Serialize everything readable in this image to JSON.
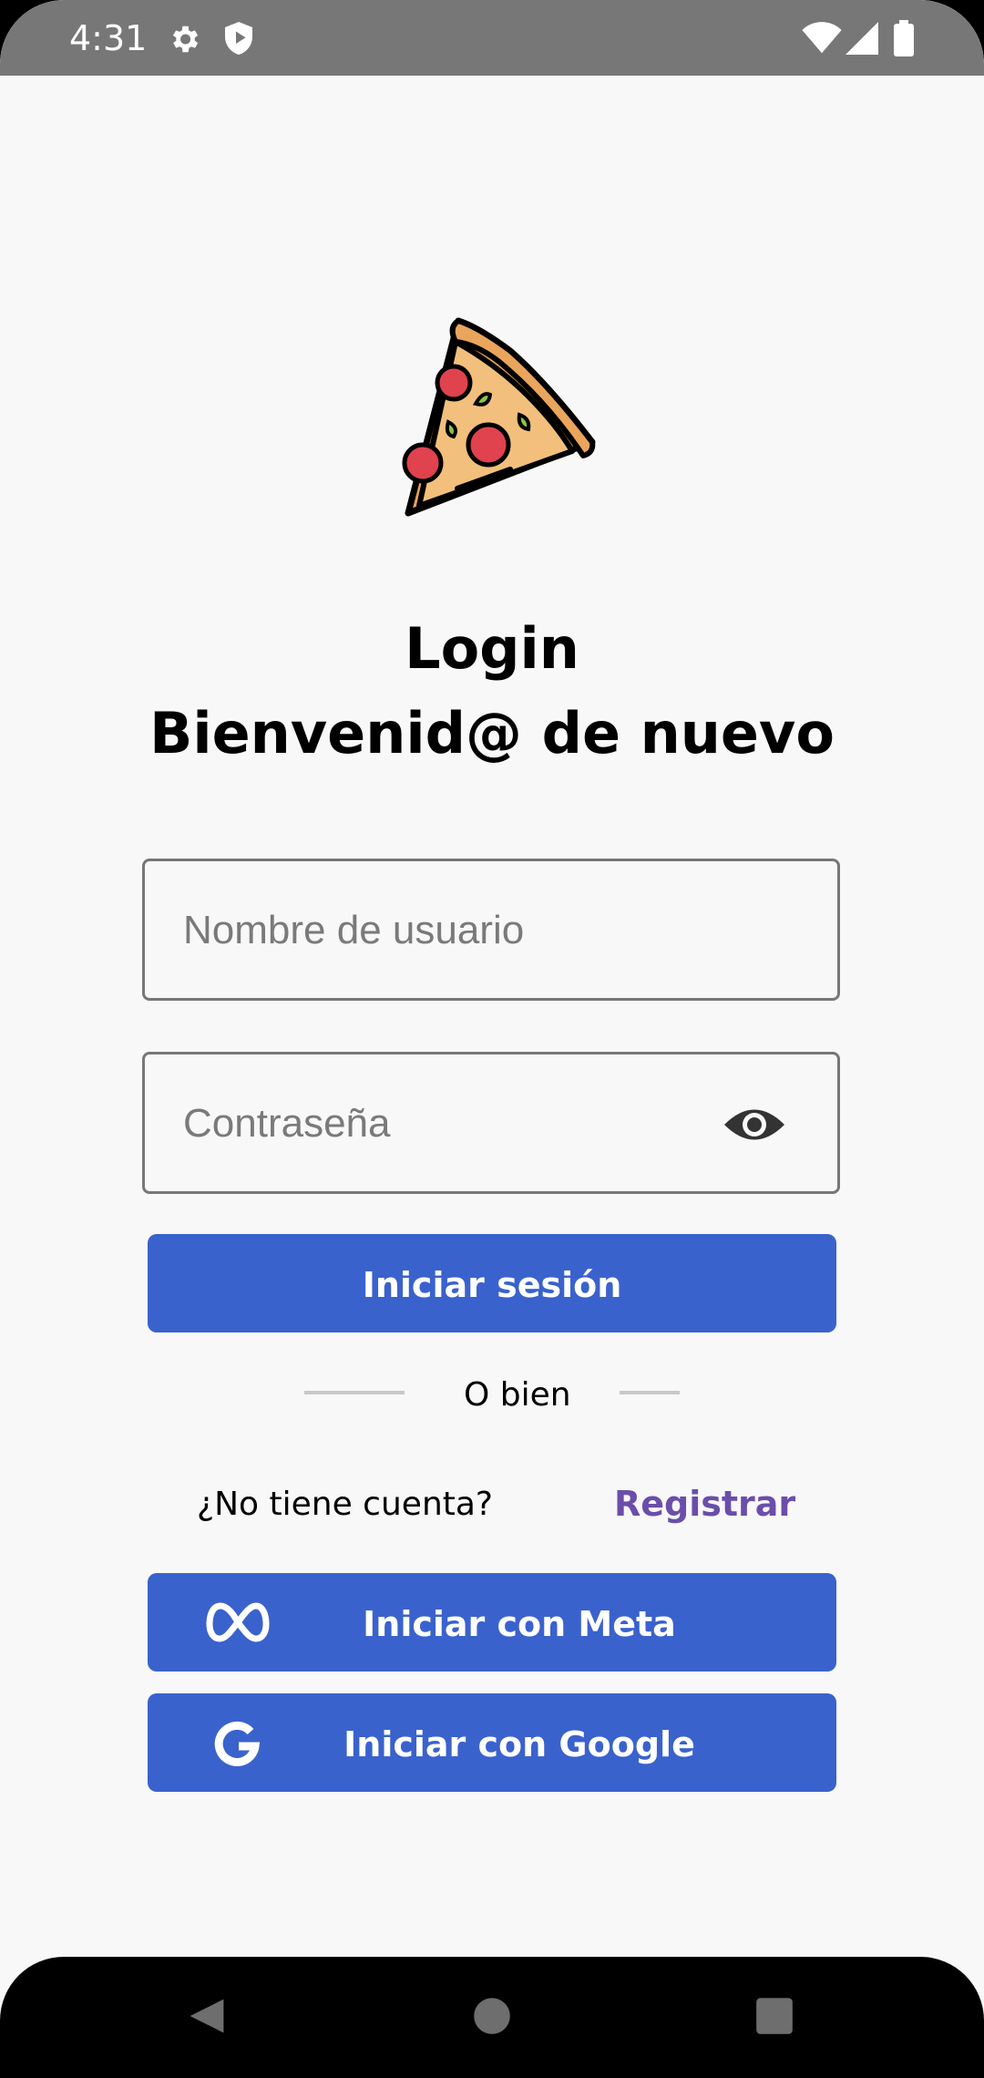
{
  "status_bar": {
    "time": "4:31",
    "icons": [
      "gear-icon",
      "shield-icon",
      "wifi-icon",
      "signal-icon",
      "battery-icon"
    ]
  },
  "logo": {
    "icon": "pizza-slice-icon"
  },
  "header": {
    "title": "Login",
    "subtitle": "Bienvenid@ de nuevo"
  },
  "form": {
    "username_placeholder": "Nombre de usuario",
    "username_value": "",
    "password_placeholder": "Contraseña",
    "password_value": "",
    "login_label": "Iniciar sesión"
  },
  "separator": {
    "label": "O bien"
  },
  "signup": {
    "prompt": "¿No tiene cuenta?",
    "link_label": "Registrar"
  },
  "social": {
    "meta_label": "Iniciar con Meta",
    "google_label": "Iniciar con Google"
  },
  "colors": {
    "primary": "#3a62cd",
    "link": "#6a4eaa",
    "status_bar": "#777777",
    "background": "#f8f8f8"
  }
}
